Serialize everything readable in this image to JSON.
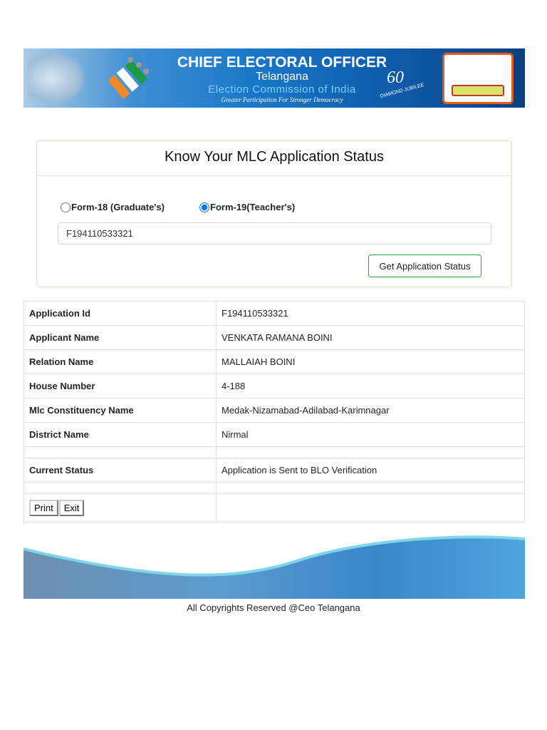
{
  "banner": {
    "title": "CHIEF ELECTORAL OFFICER",
    "state": "Telangana",
    "org": "Election Commission of India",
    "tagline": "Greater Participation For Stronger Democracy",
    "sixty": "60",
    "jubilee": "DIAMOND JUBILEE"
  },
  "form": {
    "heading": "Know Your MLC Application Status",
    "radio1": "Form-18 (Graduate's)",
    "radio2": "Form-19(Teacher's)",
    "input_value": "F194110533321",
    "submit": "Get Application Status"
  },
  "result": {
    "rows": [
      {
        "k": "Application Id",
        "v": "F194110533321"
      },
      {
        "k": "Applicant Name",
        "v": "VENKATA RAMANA BOINI"
      },
      {
        "k": "Relation Name",
        "v": "MALLAIAH BOINI"
      },
      {
        "k": "House Number",
        "v": "4-188"
      },
      {
        "k": "Mlc Constituency Name",
        "v": "Medak-Nizamabad-Adilabad-Karimnagar"
      },
      {
        "k": "District Name",
        "v": "Nirmal"
      },
      {
        "k": "Current Status",
        "v": "Application is Sent to BLO Verification"
      }
    ],
    "print": "Print",
    "exit": "Exit"
  },
  "footer": {
    "copyright": "All Copyrights Reserved @Ceo Telangana"
  }
}
